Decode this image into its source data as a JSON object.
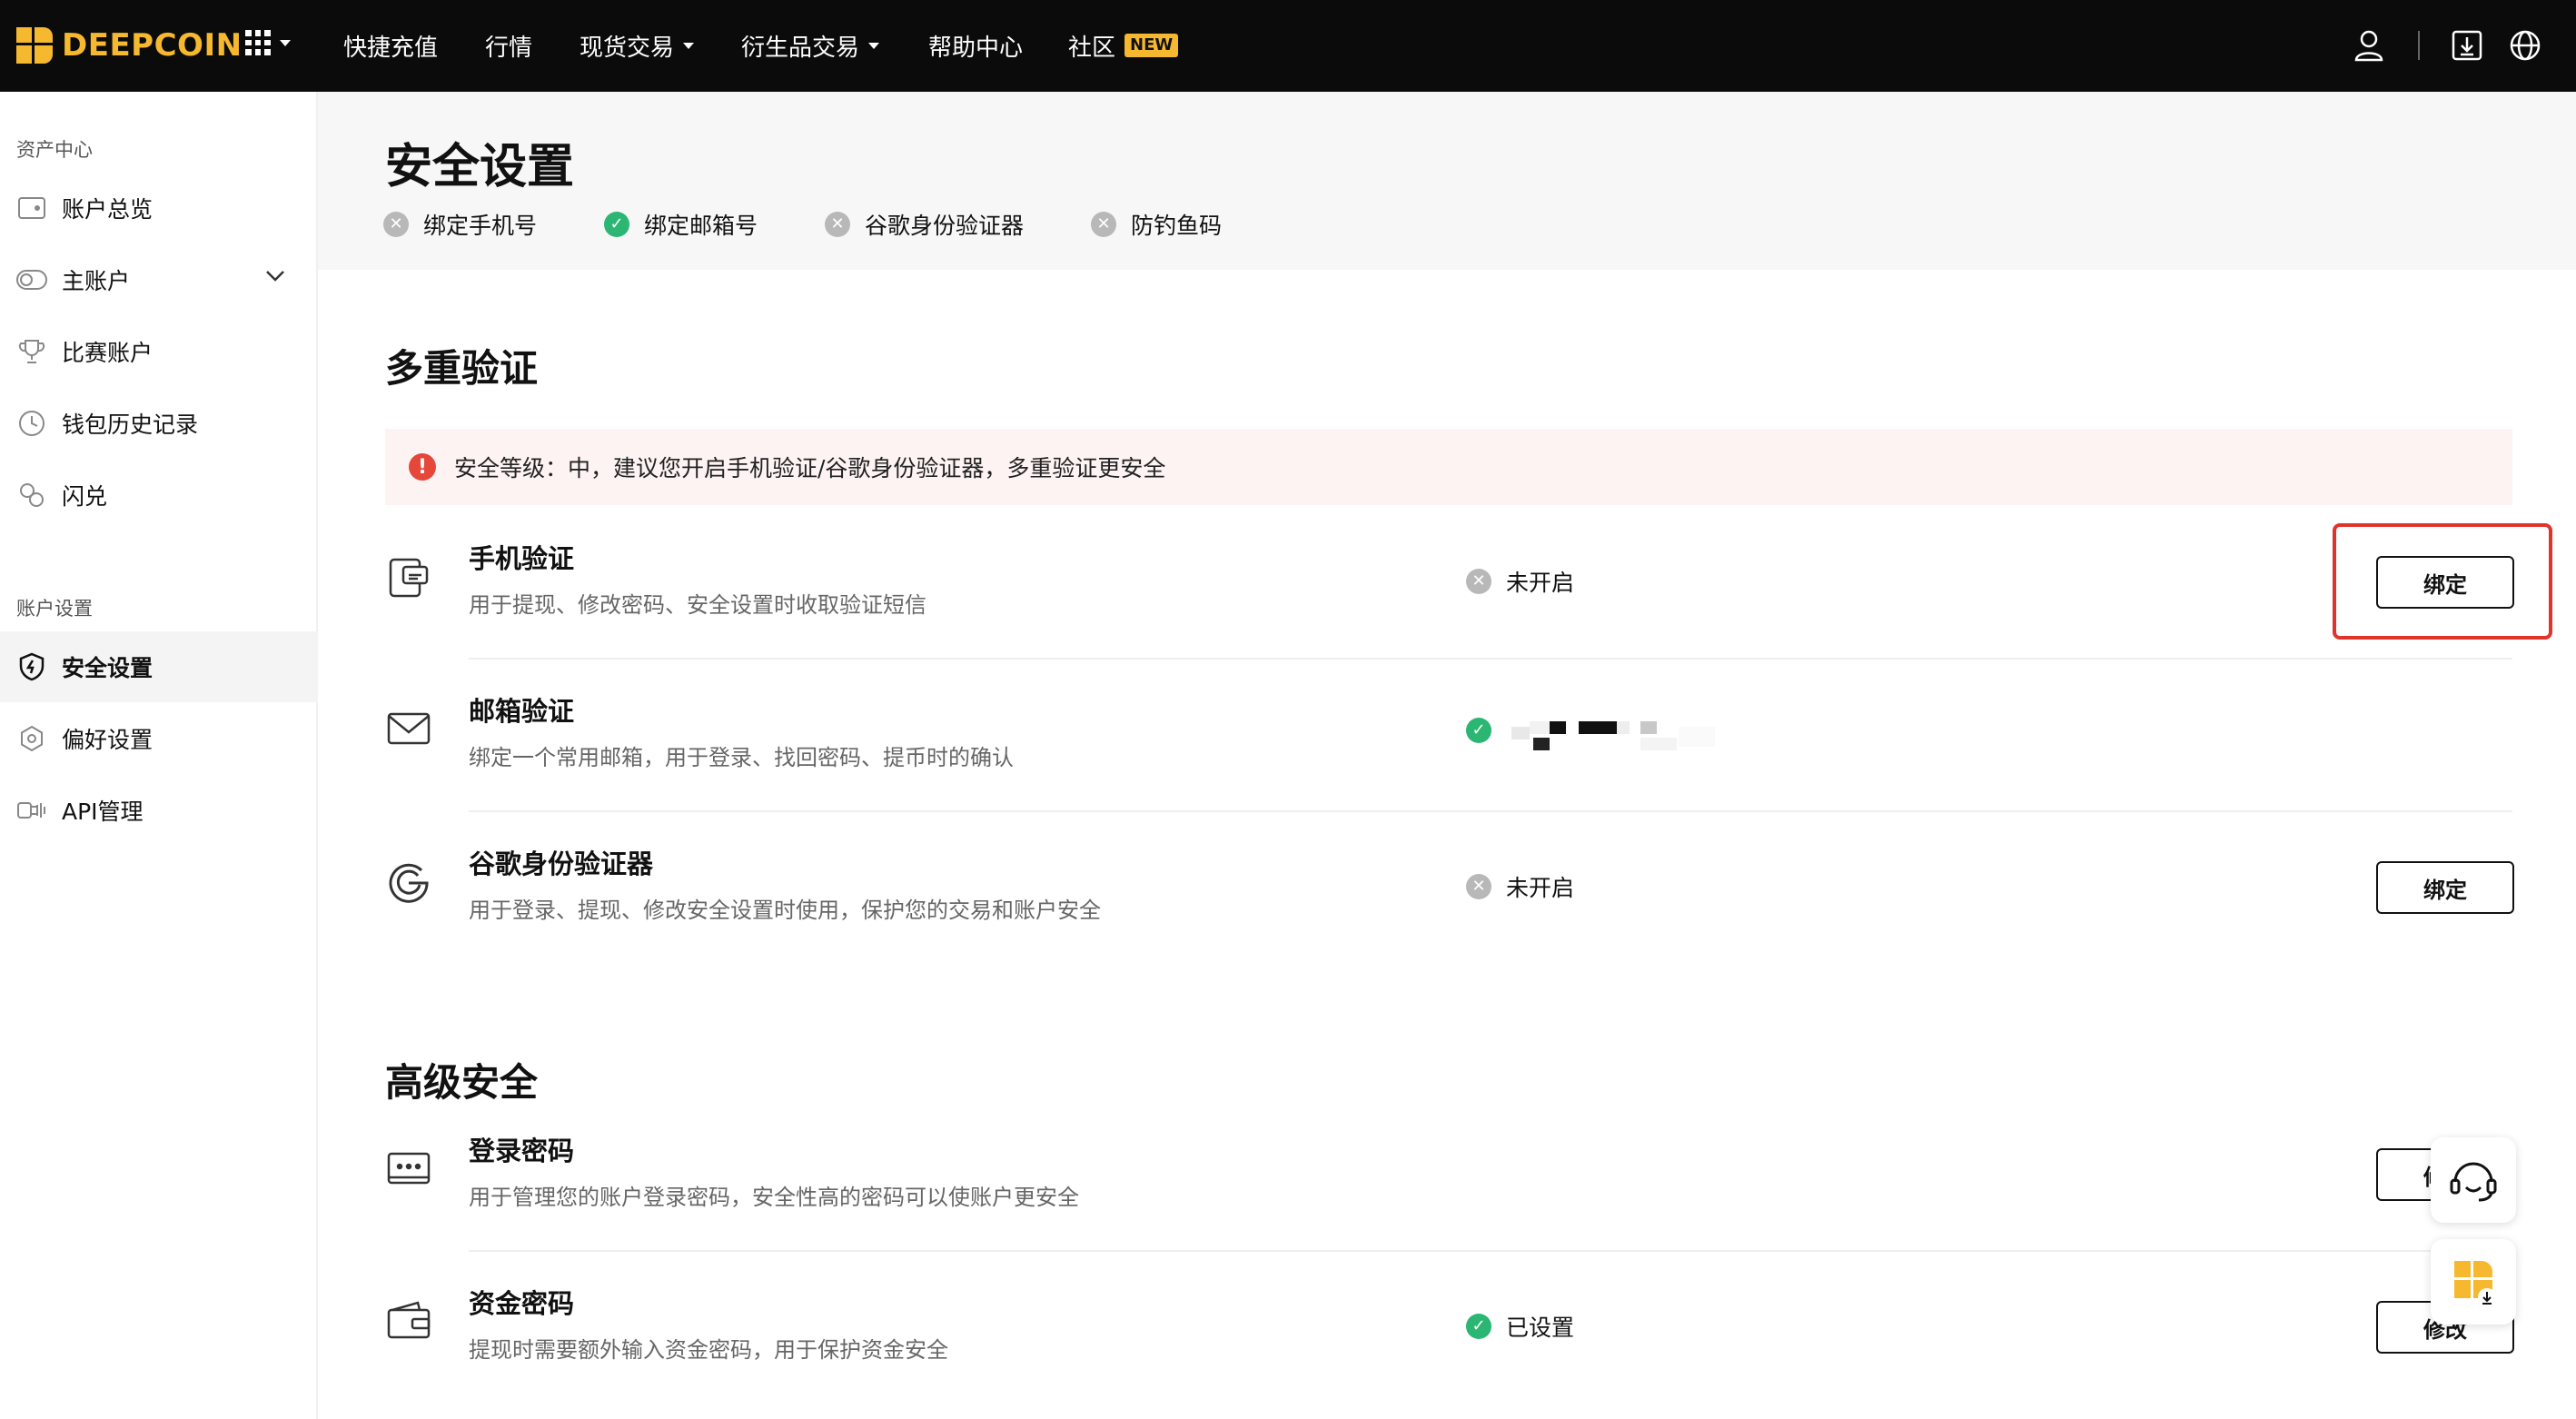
{
  "brand": {
    "name": "DEEPCOIN",
    "color": "#f5b82e"
  },
  "nav": {
    "items": [
      {
        "label": "快捷充值"
      },
      {
        "label": "行情"
      },
      {
        "label": "现货交易"
      },
      {
        "label": "衍生品交易"
      },
      {
        "label": "帮助中心"
      },
      {
        "label": "社区"
      }
    ],
    "new_badge": "NEW"
  },
  "sidebar": {
    "group1": "资产中心",
    "group2": "账户设置",
    "items": [
      {
        "label": "账户总览",
        "icon": "wallet-icon"
      },
      {
        "label": "主账户",
        "icon": "toggle-icon"
      },
      {
        "label": "比赛账户",
        "icon": "trophy-icon"
      },
      {
        "label": "钱包历史记录",
        "icon": "clock-icon"
      },
      {
        "label": "闪兑",
        "icon": "swap-icon"
      },
      {
        "label": "安全设置",
        "icon": "shield-icon"
      },
      {
        "label": "偏好设置",
        "icon": "gear-icon"
      },
      {
        "label": "API管理",
        "icon": "api-icon"
      }
    ]
  },
  "page": {
    "title": "安全设置",
    "summary": [
      {
        "label": "绑定手机号",
        "status": "off"
      },
      {
        "label": "绑定邮箱号",
        "status": "on"
      },
      {
        "label": "谷歌身份验证器",
        "status": "off"
      },
      {
        "label": "防钓鱼码",
        "status": "off"
      }
    ]
  },
  "mfa": {
    "title": "多重验证",
    "alert": "安全等级：中，建议您开启手机验证/谷歌身份验证器，多重验证更安全",
    "rows": [
      {
        "title": "手机验证",
        "desc": "用于提现、修改密码、安全设置时收取验证短信",
        "status": "未开启",
        "button": "绑定"
      },
      {
        "title": "邮箱验证",
        "desc": "绑定一个常用邮箱，用于登录、找回密码、提币时的确认",
        "status": ""
      },
      {
        "title": "谷歌身份验证器",
        "desc": "用于登录、提现、修改安全设置时使用，保护您的交易和账户安全",
        "status": "未开启",
        "button": "绑定"
      }
    ]
  },
  "advanced": {
    "title": "高级安全",
    "rows": [
      {
        "title": "登录密码",
        "desc": "用于管理您的账户登录密码，安全性高的密码可以使账户更安全",
        "button": "修改"
      },
      {
        "title": "资金密码",
        "desc": "提现时需要额外输入资金密码，用于保护资金安全",
        "status": "已设置",
        "button": "修改"
      }
    ]
  }
}
